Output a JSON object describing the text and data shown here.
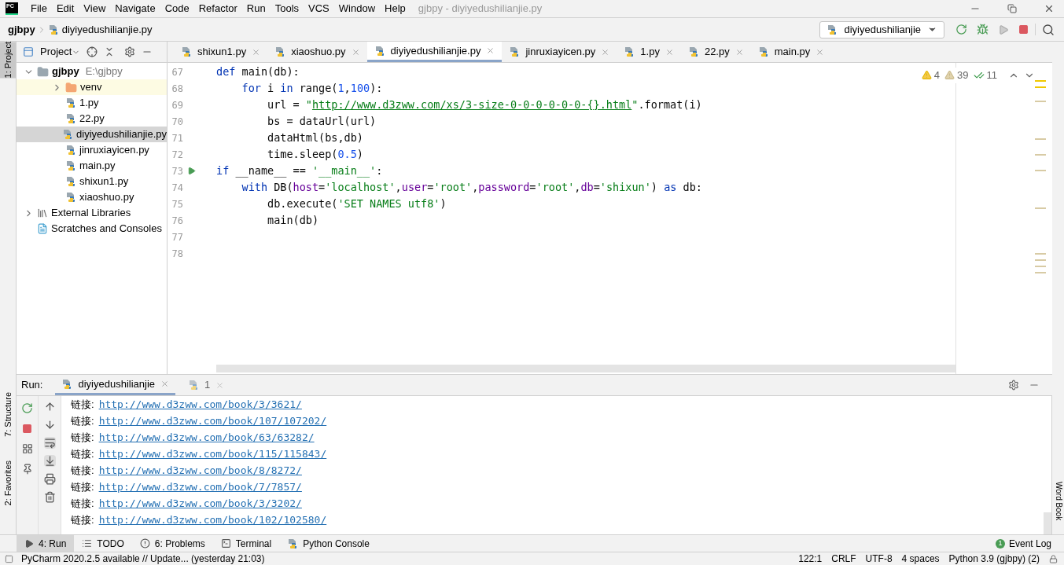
{
  "app_logo": "PC",
  "menu": [
    "File",
    "Edit",
    "View",
    "Navigate",
    "Code",
    "Refactor",
    "Run",
    "Tools",
    "VCS",
    "Window",
    "Help"
  ],
  "window": {
    "title": "gjbpy - diyiyedushilianjie.py"
  },
  "breadcrumb": [
    "gjbpy",
    "diyiyedushilianjie.py"
  ],
  "run_config": "diyiyedushilianjie",
  "left_strip": [
    {
      "label": "1: Project",
      "selected": true
    },
    {
      "label": "7: Structure",
      "selected": false
    },
    {
      "label": "2: Favorites",
      "selected": false
    }
  ],
  "right_strip": [
    "Word Book"
  ],
  "project": {
    "title": "Project",
    "tree": [
      {
        "kind": "root",
        "label": "gjbpy",
        "path": "E:\\gjbpy",
        "expanded": true,
        "selected": false,
        "children": [
          {
            "kind": "folder",
            "label": "venv",
            "expanded": false,
            "selected": false,
            "highlighted": true
          },
          {
            "kind": "file",
            "label": "1.py",
            "selected": false
          },
          {
            "kind": "file",
            "label": "22.py",
            "selected": false
          },
          {
            "kind": "file",
            "label": "diyiyedushilianjie.py",
            "selected": true
          },
          {
            "kind": "file",
            "label": "jinruxiayicen.py",
            "selected": false
          },
          {
            "kind": "file",
            "label": "main.py",
            "selected": false
          },
          {
            "kind": "file",
            "label": "shixun1.py",
            "selected": false
          },
          {
            "kind": "file",
            "label": "xiaoshuo.py",
            "selected": false
          }
        ]
      },
      {
        "kind": "library",
        "label": "External Libraries",
        "expanded": false,
        "selected": false
      },
      {
        "kind": "scratches",
        "label": "Scratches and Consoles",
        "selected": false
      }
    ]
  },
  "editor_tabs": [
    {
      "label": "shixun1.py",
      "selected": false
    },
    {
      "label": "xiaoshuo.py",
      "selected": false
    },
    {
      "label": "diyiyedushilianjie.py",
      "selected": true
    },
    {
      "label": "jinruxiayicen.py",
      "selected": false
    },
    {
      "label": "1.py",
      "selected": false
    },
    {
      "label": "22.py",
      "selected": false
    },
    {
      "label": "main.py",
      "selected": false
    }
  ],
  "inspections": [
    {
      "kind": "warning",
      "count": "4"
    },
    {
      "kind": "weak",
      "count": "39"
    },
    {
      "kind": "typo",
      "count": "11"
    }
  ],
  "code_lines": [
    {
      "number": "67",
      "tokens": [
        {
          "kind": "keyword",
          "text": "def"
        },
        {
          "kind": "plain",
          "text": " main(db):"
        }
      ]
    },
    {
      "number": "68",
      "tokens": [
        {
          "kind": "keyword",
          "text": "    for"
        },
        {
          "kind": "plain",
          "text": " i "
        },
        {
          "kind": "keyword",
          "text": "in"
        },
        {
          "kind": "plain",
          "text": " range("
        },
        {
          "kind": "number",
          "text": "1"
        },
        {
          "kind": "plain",
          "text": ","
        },
        {
          "kind": "number",
          "text": "100"
        },
        {
          "kind": "plain",
          "text": "):"
        }
      ]
    },
    {
      "number": "69",
      "tokens": [
        {
          "kind": "plain",
          "text": "        url = "
        },
        {
          "kind": "string",
          "text": "\""
        },
        {
          "kind": "link",
          "text": "http://www.d3zww.com/xs/3-size-0-0-0-0-0-0-{}.html"
        },
        {
          "kind": "string",
          "text": "\""
        },
        {
          "kind": "plain",
          "text": ".format(i)"
        }
      ]
    },
    {
      "number": "70",
      "tokens": [
        {
          "kind": "plain",
          "text": "        bs = dataUrl(url)"
        }
      ]
    },
    {
      "number": "71",
      "tokens": [
        {
          "kind": "plain",
          "text": "        dataHtml(bs,db)"
        }
      ]
    },
    {
      "number": "72",
      "tokens": [
        {
          "kind": "plain",
          "text": "        time.sleep("
        },
        {
          "kind": "number",
          "text": "0.5"
        },
        {
          "kind": "plain",
          "text": ")"
        }
      ]
    },
    {
      "number": "73",
      "run": true,
      "tokens": [
        {
          "kind": "keyword",
          "text": "if"
        },
        {
          "kind": "plain",
          "text": " __name__ == "
        },
        {
          "kind": "string",
          "text": "'__main__'"
        },
        {
          "kind": "plain",
          "text": ":"
        }
      ]
    },
    {
      "number": "74",
      "tokens": [
        {
          "kind": "keyword",
          "text": "    with"
        },
        {
          "kind": "plain",
          "text": " DB("
        },
        {
          "kind": "param",
          "text": "host"
        },
        {
          "kind": "plain",
          "text": "="
        },
        {
          "kind": "string",
          "text": "'localhost'"
        },
        {
          "kind": "plain",
          "text": ","
        },
        {
          "kind": "param",
          "text": "user"
        },
        {
          "kind": "plain",
          "text": "="
        },
        {
          "kind": "string",
          "text": "'root'"
        },
        {
          "kind": "plain",
          "text": ","
        },
        {
          "kind": "param",
          "text": "password"
        },
        {
          "kind": "plain",
          "text": "="
        },
        {
          "kind": "string",
          "text": "'root'"
        },
        {
          "kind": "plain",
          "text": ","
        },
        {
          "kind": "param",
          "text": "db"
        },
        {
          "kind": "plain",
          "text": "="
        },
        {
          "kind": "string",
          "text": "'shixun'"
        },
        {
          "kind": "plain",
          "text": ") "
        },
        {
          "kind": "keyword",
          "text": "as"
        },
        {
          "kind": "plain",
          "text": " db:"
        }
      ]
    },
    {
      "number": "75",
      "tokens": [
        {
          "kind": "plain",
          "text": "        db.execute("
        },
        {
          "kind": "string",
          "text": "'SET NAMES utf8'"
        },
        {
          "kind": "plain",
          "text": ")"
        }
      ]
    },
    {
      "number": "76",
      "tokens": [
        {
          "kind": "plain",
          "text": "        main(db)"
        }
      ]
    },
    {
      "number": "77"
    },
    {
      "number": "78"
    }
  ],
  "run_panel": {
    "title": "Run:",
    "tabs": [
      {
        "label": "diyiyedushilianjie",
        "selected": true
      },
      {
        "label": "1",
        "selected": false
      }
    ],
    "output": [
      {
        "label": "链接:",
        "url": "http://www.d3zww.com/book/3/3621/"
      },
      {
        "label": "链接:",
        "url": "http://www.d3zww.com/book/107/107202/"
      },
      {
        "label": "链接:",
        "url": "http://www.d3zww.com/book/63/63282/"
      },
      {
        "label": "链接:",
        "url": "http://www.d3zww.com/book/115/115843/"
      },
      {
        "label": "链接:",
        "url": "http://www.d3zww.com/book/8/8272/"
      },
      {
        "label": "链接:",
        "url": "http://www.d3zww.com/book/7/7857/"
      },
      {
        "label": "链接:",
        "url": "http://www.d3zww.com/book/3/3202/"
      },
      {
        "label": "链接:",
        "url": "http://www.d3zww.com/book/102/102580/"
      }
    ]
  },
  "tool_tabs": [
    {
      "kind": "run",
      "label": "4: Run",
      "selected": true
    },
    {
      "kind": "todo",
      "label": "TODO",
      "selected": false
    },
    {
      "kind": "problems",
      "label": "6: Problems",
      "selected": false
    },
    {
      "kind": "terminal",
      "label": "Terminal",
      "selected": false
    },
    {
      "kind": "console",
      "label": "Python Console",
      "selected": false
    }
  ],
  "event_log": {
    "count": "1",
    "label": "Event Log"
  },
  "status_bar": {
    "message": "PyCharm 2020.2.5 available // Update... (yesterday 21:03)",
    "items": [
      "122:1",
      "CRLF",
      "UTF-8",
      "4 spaces",
      "Python 3.9 (gjbpy) (2)"
    ]
  }
}
